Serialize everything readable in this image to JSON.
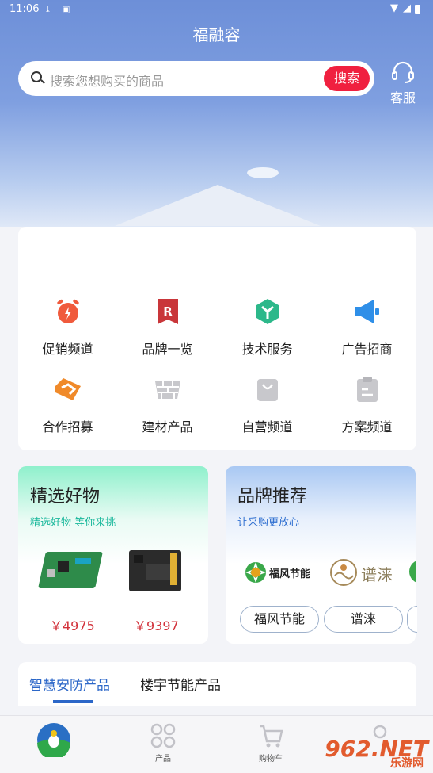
{
  "status_bar": {
    "time": "11:06"
  },
  "header": {
    "title": "福融容",
    "search_placeholder": "搜索您想购买的商品",
    "search_button": "搜索",
    "service_label": "客服"
  },
  "categories": [
    {
      "label": "促销频道",
      "icon": "alarm-clock-icon",
      "color": "#f05a3c"
    },
    {
      "label": "品牌一览",
      "icon": "brand-r-icon",
      "color": "#c9363a"
    },
    {
      "label": "技术服务",
      "icon": "tech-service-icon",
      "color": "#2cb88a"
    },
    {
      "label": "广告招商",
      "icon": "megaphone-icon",
      "color": "#2f8fe8"
    },
    {
      "label": "合作招募",
      "icon": "handshake-icon",
      "color": "#f08a2a"
    },
    {
      "label": "建材产品",
      "icon": "bricks-icon",
      "color": "#c8c8cc"
    },
    {
      "label": "自营频道",
      "icon": "shopping-bag-icon",
      "color": "#c8c8cc"
    },
    {
      "label": "方案频道",
      "icon": "clipboard-icon",
      "color": "#c8c8cc"
    }
  ],
  "promo_left": {
    "title": "精选好物",
    "subtitle": "精选好物 等你来挑",
    "subtitle_color": "#17b79a",
    "products": [
      {
        "price": "￥4975",
        "image": "green-circuit-board"
      },
      {
        "price": "￥9397",
        "image": "black-controller-board"
      }
    ]
  },
  "promo_right": {
    "title": "品牌推荐",
    "subtitle": "让采购更放心",
    "subtitle_color": "#2f6fd0",
    "logos": [
      {
        "text": "福风节能",
        "icon": "fufeng-logo"
      },
      {
        "text": "谱涞",
        "icon": "pulai-logo"
      }
    ],
    "brands": [
      "福风节能",
      "谱涞"
    ]
  },
  "tabs": [
    {
      "label": "智慧安防产品",
      "active": true
    },
    {
      "label": "楼宇节能产品",
      "active": false
    }
  ],
  "bottom_nav": [
    {
      "label": "",
      "icon": "home-logo-icon"
    },
    {
      "label": "产品",
      "icon": "grid-icon"
    },
    {
      "label": "购物车",
      "icon": "cart-icon"
    },
    {
      "label": "",
      "icon": "user-icon"
    }
  ],
  "watermark": {
    "main": "962.NET",
    "sub": "乐游网"
  },
  "colors": {
    "accent": "#2c67c8",
    "search_button": "#f0203f",
    "price": "#d2313a"
  }
}
